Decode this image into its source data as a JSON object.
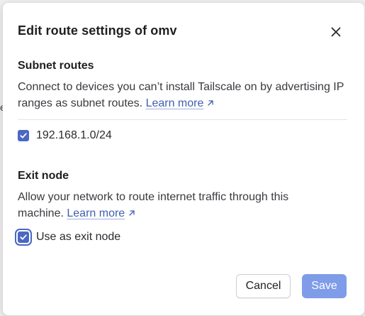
{
  "dialog": {
    "title": "Edit route settings of omv",
    "close_icon": "close-icon"
  },
  "subnet": {
    "heading": "Subnet routes",
    "description": "Connect to devices you can’t install Tailscale on by advertising IP ranges as subnet routes.",
    "learn_more": "Learn more",
    "routes": [
      {
        "label": "192.168.1.0/24",
        "checked": true
      }
    ]
  },
  "exit_node": {
    "heading": "Exit node",
    "description": "Allow your network to route internet traffic through this machine.",
    "learn_more": "Learn more",
    "option_label": "Use as exit node",
    "option_checked": true
  },
  "buttons": {
    "cancel": "Cancel",
    "save": "Save"
  },
  "colors": {
    "accent": "#4a68c4",
    "save_disabled": "#7f9ce8",
    "link": "#3f5fb0"
  }
}
